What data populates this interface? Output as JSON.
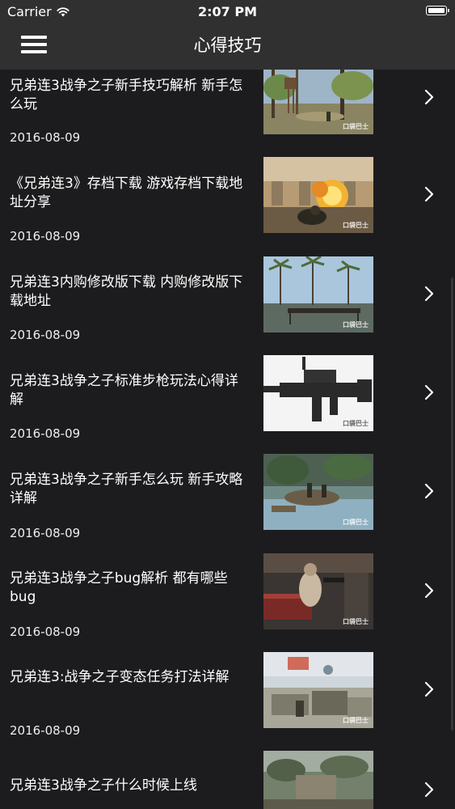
{
  "status_bar": {
    "carrier": "Carrier",
    "time": "2:07 PM",
    "wifi_icon": "wifi-icon",
    "battery_icon": "battery-icon"
  },
  "nav": {
    "title": "心得技巧",
    "menu_icon": "hamburger-menu-icon"
  },
  "articles": [
    {
      "title": "兄弟连3战争之子新手技巧解析 新手怎么玩",
      "date": "2016-08-09",
      "thumb_scene": "sunny forest with watchtower",
      "thumb_watermark": "口袋巴士"
    },
    {
      "title": "《兄弟连3》存档下载 游戏存档下载地址分享",
      "date": "2016-08-09",
      "thumb_scene": "explosion in ruined building",
      "thumb_watermark": "口袋巴士"
    },
    {
      "title": "兄弟连3内购修改版下载 内购修改版下载地址",
      "date": "2016-08-09",
      "thumb_scene": "palm trees with wooden bridge",
      "thumb_watermark": "口袋巴士"
    },
    {
      "title": "兄弟连3战争之子标准步枪玩法心得详解",
      "date": "2016-08-09",
      "thumb_scene": "assault rifle on white background",
      "thumb_watermark": "口袋巴士"
    },
    {
      "title": "兄弟连3战争之子新手怎么玩 新手攻略详解",
      "date": "2016-08-09",
      "thumb_scene": "soldiers crossing a river",
      "thumb_watermark": "口袋巴士"
    },
    {
      "title": "兄弟连3战争之子bug解析 都有哪些bug",
      "date": "2016-08-09",
      "thumb_scene": "soldier in dark interior",
      "thumb_watermark": "口袋巴士"
    },
    {
      "title": "兄弟连3:战争之子变态任务打法详解",
      "date": "2016-08-09",
      "thumb_scene": "soldier behind crates in town",
      "thumb_watermark": "口袋巴士"
    },
    {
      "title": "兄弟连3战争之子什么时候上线",
      "date": "",
      "thumb_scene": "battlefield ruins",
      "thumb_watermark": ""
    }
  ],
  "chevron_icon": "chevron-right-icon",
  "colors": {
    "nav_background": "#303031",
    "list_background": "#1c1c1e",
    "text": "#ffffff"
  }
}
